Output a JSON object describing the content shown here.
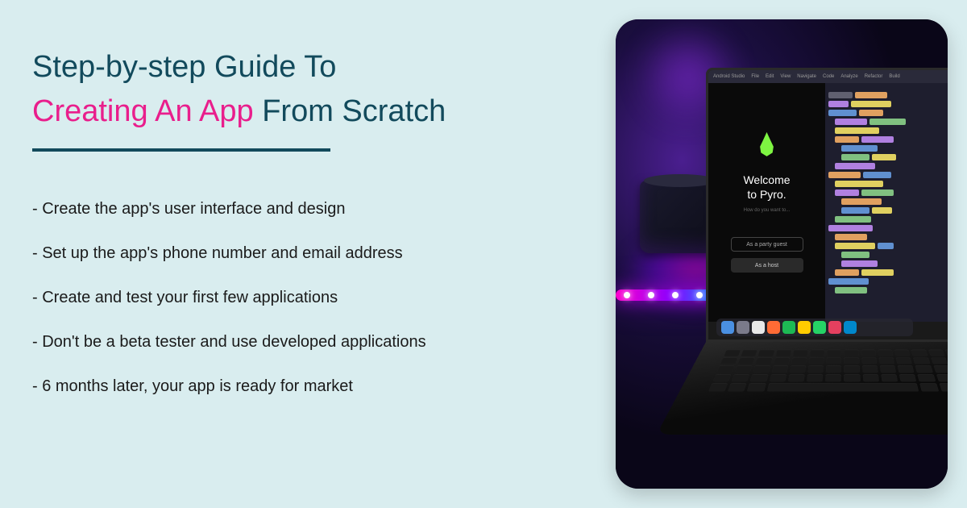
{
  "title": {
    "part1": "Step-by-step Guide To",
    "highlight": "Creating An App",
    "part2": "From Scratch"
  },
  "steps": [
    "- Create the app's user interface and design",
    "- Set up the app's phone number and email address",
    "- Create and test your first few applications",
    "- Don't be a beta tester and use developed applications",
    "- 6 months later, your app is ready for market"
  ],
  "image": {
    "welcome_line1": "Welcome",
    "welcome_line2": "to Pyro.",
    "btn_guest": "As a party guest",
    "btn_host": "As a host",
    "menu_items": [
      "Android Studio",
      "File",
      "Edit",
      "View",
      "Navigate",
      "Code",
      "Analyze",
      "Refactor",
      "Build"
    ]
  }
}
